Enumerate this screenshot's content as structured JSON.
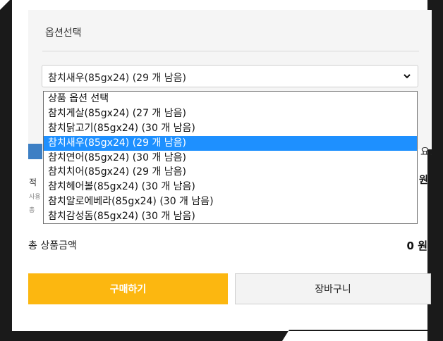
{
  "option_panel": {
    "title": "옵션선택",
    "select_value": "참치새우(85gx24) (29 개 남음)"
  },
  "dropdown": {
    "options": [
      "상품 옵션 선택",
      "참치게살(85gx24) (27 개 남음)",
      "참치닭고기(85gx24) (30 개 남음)",
      "참치새우(85gx24) (29 개 남음)",
      "참치연어(85gx24) (30 개 남음)",
      "참치치어(85gx24) (29 개 남음)",
      "참치헤어볼(85gx24) (30 개 남음)",
      "참치알로에베라(85gx24) (30 개 남음)",
      "참치감성돔(85gx24) (30 개 남음)"
    ],
    "selected_index": 3
  },
  "background_peek": {
    "text_yo": "요.",
    "text_won": "원",
    "text_a": "적",
    "text_b": "사용",
    "text_c": "총"
  },
  "total": {
    "label": "총 상품금액",
    "value": "0 원"
  },
  "buttons": {
    "buy": "구매하기",
    "cart": "장바구니"
  },
  "colors": {
    "selected_option": "#1e90ff",
    "buy_button": "#fcb710",
    "accent_blue": "#3d7fc4"
  }
}
